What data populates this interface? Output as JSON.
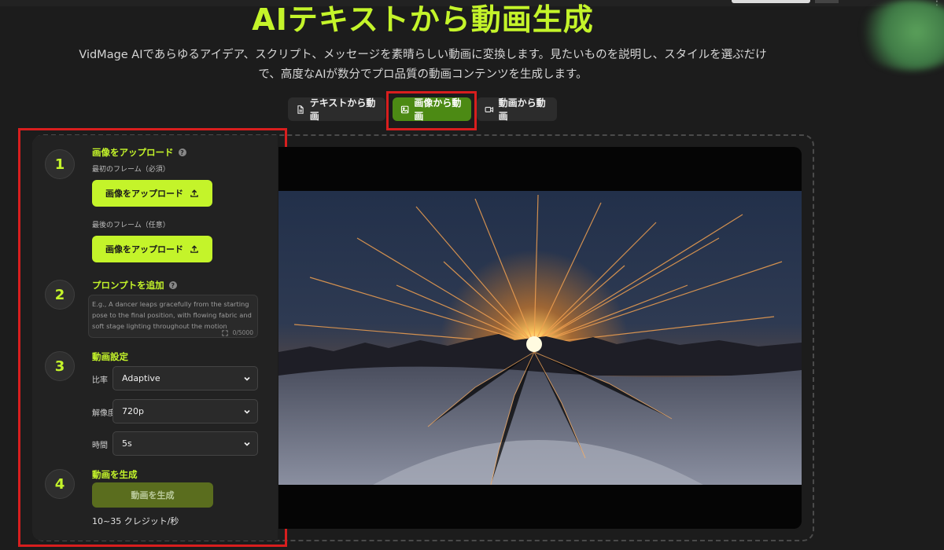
{
  "header": {
    "title": "AIテキストから動画生成",
    "subtitle_line1": "VidMage AIであらゆるアイデア、スクリプト、メッセージを素晴らしい動画に変換します。見たいものを説明し、スタイルを選ぶだけ",
    "subtitle_line2": "で、高度なAIが数分でプロ品質の動画コンテンツを生成します。"
  },
  "tabs": [
    {
      "label": "テキストから動画",
      "icon": "document-icon",
      "active": false
    },
    {
      "label": "画像から動画",
      "icon": "image-icon",
      "active": true
    },
    {
      "label": "動画から動画",
      "icon": "video-camera-icon",
      "active": false
    }
  ],
  "steps": {
    "step1": {
      "number": "1",
      "title": "画像をアップロード",
      "first_frame_label": "最初のフレーム（必須）",
      "last_frame_label": "最後のフレーム（任意）",
      "upload_label": "画像をアップロード"
    },
    "step2": {
      "number": "2",
      "title": "プロンプトを追加",
      "placeholder": "E.g., A dancer leaps gracefully from the starting pose to the final position, with flowing fabric and soft stage lighting throughout the motion",
      "counter": "0/5000"
    },
    "step3": {
      "number": "3",
      "title": "動画設定",
      "ratio_label": "比率",
      "ratio_value": "Adaptive",
      "resolution_label": "解像度",
      "resolution_value": "720p",
      "duration_label": "時間",
      "duration_value": "5s"
    },
    "step4": {
      "number": "4",
      "title": "動画を生成",
      "generate_label": "動画を生成",
      "credits": "10~35 クレジット/秒"
    }
  },
  "colors": {
    "accent": "#c4f42a",
    "active_tab": "#4c8a14",
    "highlight": "#d81e1e",
    "background": "#1c1c1c"
  }
}
